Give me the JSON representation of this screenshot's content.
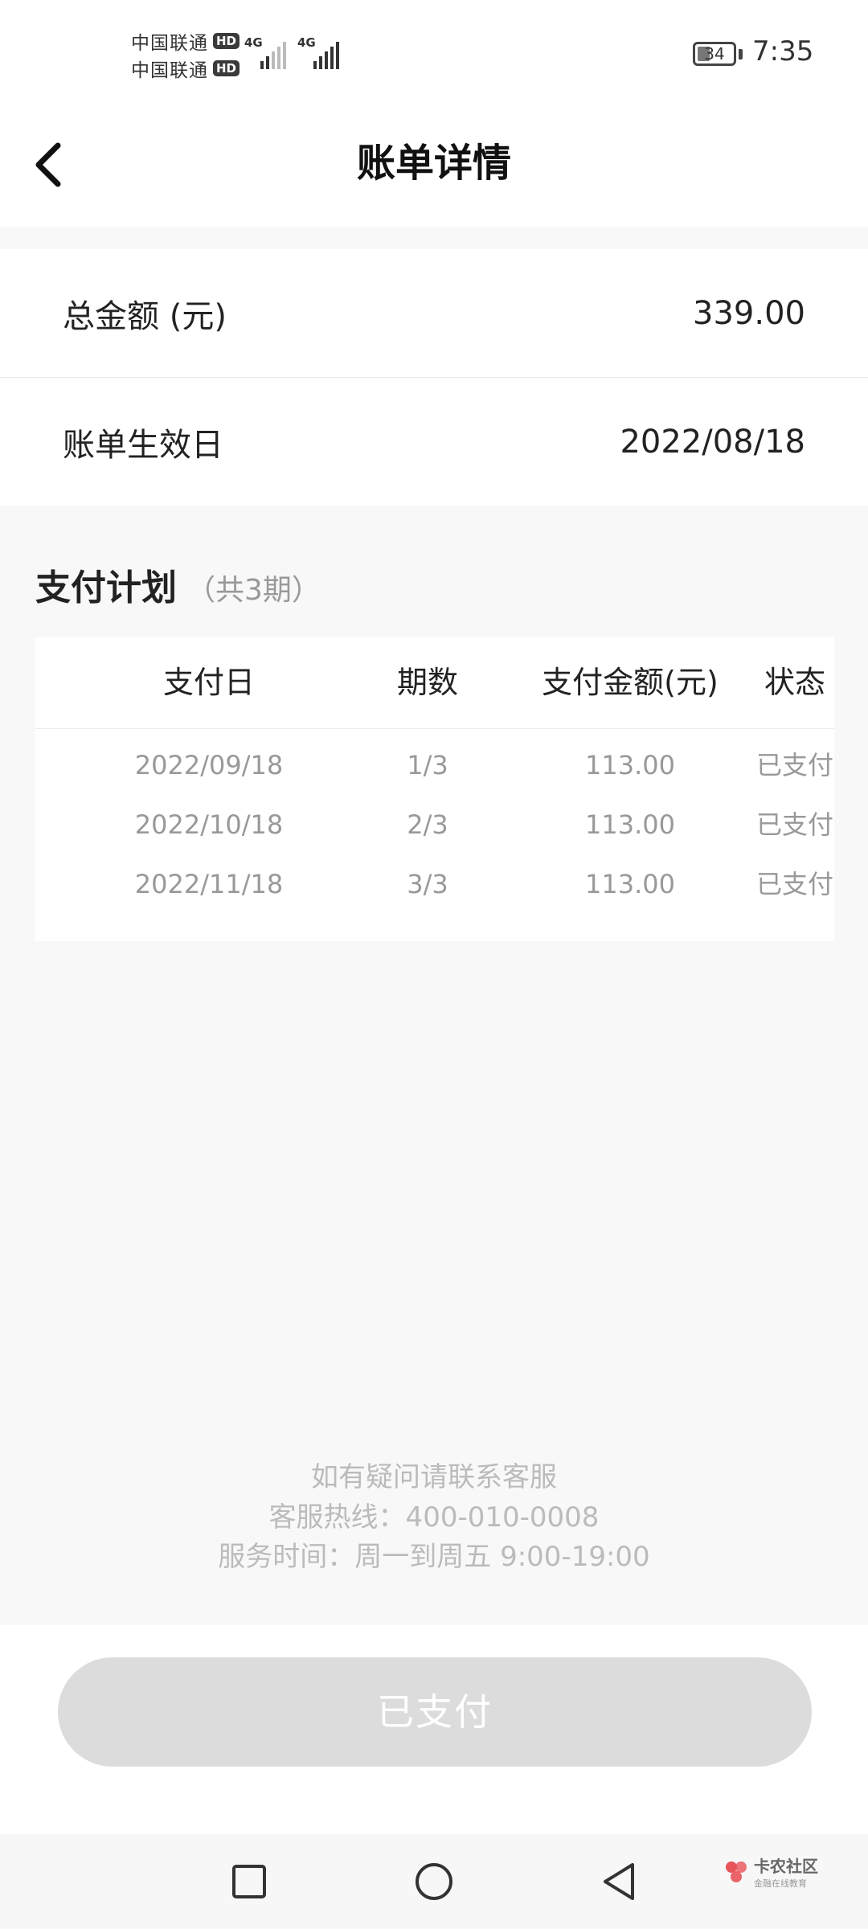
{
  "status_bar": {
    "carriers": [
      {
        "name": "中国联通",
        "badge": "HD"
      },
      {
        "name": "中国联通",
        "badge": "HD"
      }
    ],
    "network_1": "4G",
    "network_2": "4G",
    "battery": "34",
    "time": "7:35"
  },
  "header": {
    "title": "账单详情",
    "back_icon": "chevron-left-icon"
  },
  "summary": {
    "total_label": "总金额 (元)",
    "total_value": "339.00",
    "effective_label": "账单生效日",
    "effective_value": "2022/08/18"
  },
  "plan": {
    "title": "支付计划",
    "count": "（共3期）",
    "columns": [
      "支付日",
      "期数",
      "支付金额(元)",
      "状态"
    ],
    "rows": [
      {
        "date": "2022/09/18",
        "period": "1/3",
        "amount": "113.00",
        "status": "已支付"
      },
      {
        "date": "2022/10/18",
        "period": "2/3",
        "amount": "113.00",
        "status": "已支付"
      },
      {
        "date": "2022/11/18",
        "period": "3/3",
        "amount": "113.00",
        "status": "已支付"
      }
    ]
  },
  "contact": {
    "line1": "如有疑问请联系客服",
    "line2": "客服热线：400-010-0008",
    "line3": "服务时间：周一到周五 9:00-19:00"
  },
  "action": {
    "button_label": "已支付"
  },
  "watermark": {
    "main": "卡农社区",
    "sub": "金融在线教育"
  },
  "colors": {
    "button_bg": "#dcdcdc",
    "muted_text": "#999999",
    "hint_text": "#bbbbbb"
  }
}
